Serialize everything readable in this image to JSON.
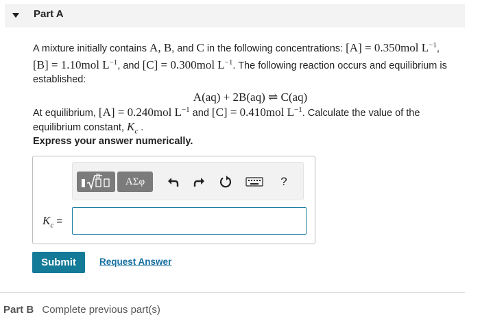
{
  "part_a": {
    "title": "Part A"
  },
  "problem": {
    "intro": "A mixture initially contains ",
    "species": [
      "A",
      "B",
      "C"
    ],
    "intro2": " in the following concentrations: ",
    "conc_A": "[A] = 0.350mol L",
    "conc_B": "[B] = 1.10mol L",
    "conc_C": "[C] = 0.300mol L",
    "exp": "−1",
    "text_and": ", and ",
    "text_after": ". The following reaction occurs and equilibrium is established:",
    "equation": "A(aq) + 2B(aq) ⇌ C(aq)",
    "eq_intro": "At equilibrium, ",
    "eq_A": "[A] = 0.240mol L",
    "eq_and": " and ",
    "eq_C": "[C] = 0.410mol L",
    "eq_after": ". Calculate the value of the equilibrium constant, ",
    "kc_symbol": "K",
    "kc_sub": "c",
    "period": " ."
  },
  "instruction": "Express your answer numerically.",
  "toolbar": {
    "template_icon": "template-sqrt-icon",
    "greek_label": "ΑΣφ",
    "undo_icon": "undo-icon",
    "redo_icon": "redo-icon",
    "reset_icon": "reset-icon",
    "keyboard_icon": "keyboard-icon",
    "help_label": "?"
  },
  "answer": {
    "label_symbol": "K",
    "label_sub": "c",
    "label_eq": " =",
    "value": ""
  },
  "actions": {
    "submit": "Submit",
    "request": "Request Answer"
  },
  "part_b": {
    "label": "Part B",
    "status": "Complete previous part(s)"
  },
  "colors": {
    "accent": "#137a98",
    "link": "#156ea0"
  }
}
